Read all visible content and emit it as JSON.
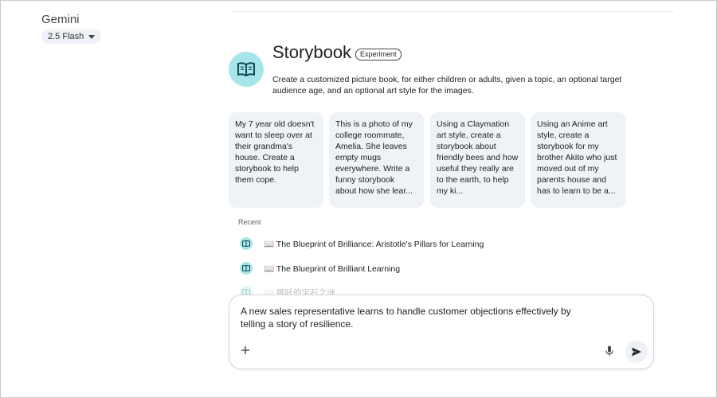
{
  "app": {
    "title": "Gemini",
    "model": "2.5 Flash"
  },
  "gem": {
    "icon": "book-open-icon",
    "name": "Storybook",
    "badge": "Experiment",
    "description": "Create a customized picture book, for either children or adults, given a topic, an optional target audience age, and an optional art style for the images.",
    "avatar_color": "#a6e6ea"
  },
  "suggestions": [
    {
      "text": "My 7 year old doesn't want to sleep over at their grandma's house. Create a storybook to help them cope."
    },
    {
      "text": "This is a photo of my college roommate, Amelia. She leaves empty mugs everywhere. Write a funny storybook about how she lear..."
    },
    {
      "text": "Using a Claymation art style, create a storybook about friendly bees and how useful they really are to the earth, to help my ki..."
    },
    {
      "text": "Using an Anime art style, create a storybook for my brother Akito who just moved out of my parents house and has to learn to be a..."
    }
  ],
  "recent": {
    "label": "Recent",
    "items": [
      {
        "title": "📖 The Blueprint of Brilliance: Aristotle's Pillars for Learning"
      },
      {
        "title": "📖 The Blueprint of Brilliant Learning"
      },
      {
        "title": "📖 哪吒的宝石之谜"
      }
    ]
  },
  "composer": {
    "text": "A new sales representative learns to handle customer objections effectively by telling a story of resilience.",
    "icons": [
      "plus-icon",
      "mic-icon",
      "send-icon"
    ]
  }
}
